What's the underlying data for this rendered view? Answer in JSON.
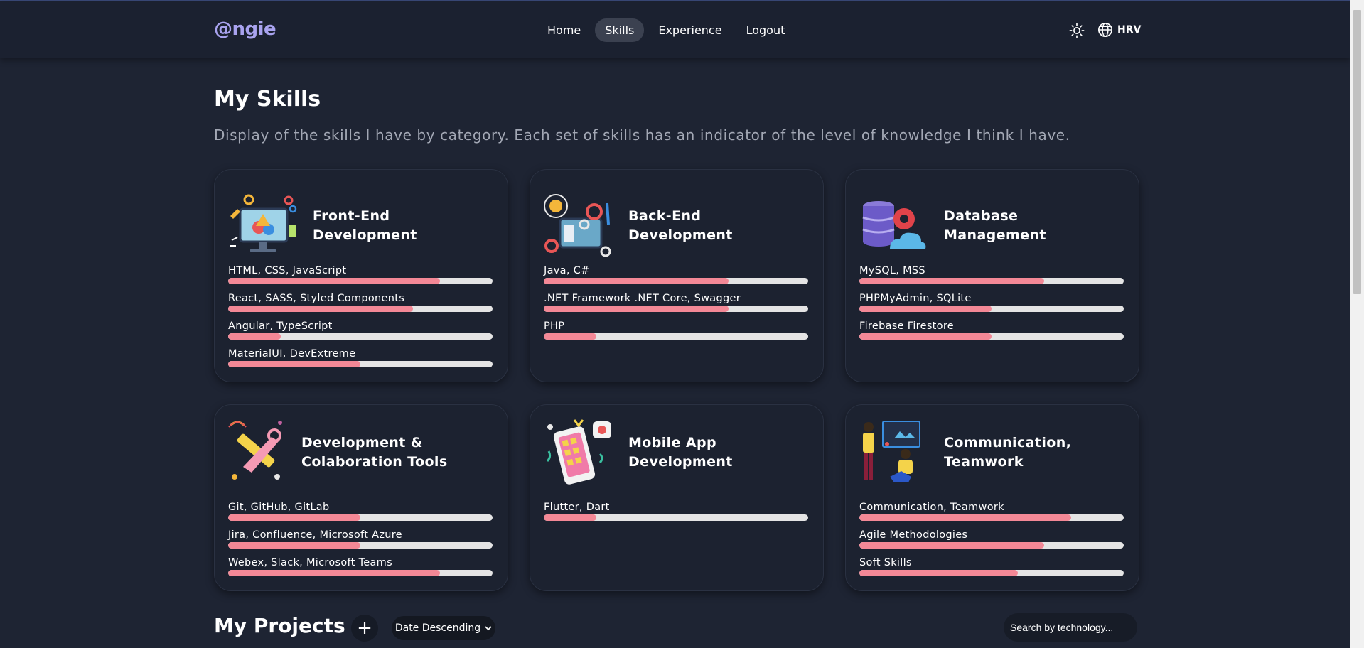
{
  "app": {
    "logo": "@ngie"
  },
  "nav": {
    "items": [
      {
        "label": "Home",
        "active": false
      },
      {
        "label": "Skills",
        "active": true
      },
      {
        "label": "Experience",
        "active": false
      },
      {
        "label": "Logout",
        "active": false
      }
    ],
    "language": "HRV",
    "theme_icon": "sun-icon",
    "language_icon": "globe-icon"
  },
  "page": {
    "title": "My Skills",
    "subtitle": "Display of the skills I have by category. Each set of skills has an indicator of the level of knowledge I think I have."
  },
  "colors": {
    "accent": "#a9a3ef",
    "progress_fill": "#f38896",
    "progress_track": "#e4e4e4",
    "card_bg": "#1c2230",
    "page_bg": "#1e2433"
  },
  "cards": [
    {
      "title": "Front-End Development",
      "icon": "monitor-design-icon",
      "skills": [
        {
          "name": "HTML, CSS, JavaScript",
          "level": 0.8
        },
        {
          "name": "React, SASS, Styled Components",
          "level": 0.7
        },
        {
          "name": "Angular, TypeScript",
          "level": 0.2
        },
        {
          "name": "MaterialUI, DevExtreme",
          "level": 0.5
        }
      ]
    },
    {
      "title": "Back-End Development",
      "icon": "server-gears-icon",
      "skills": [
        {
          "name": "Java, C#",
          "level": 0.7
        },
        {
          "name": ".NET Framework .NET Core, Swagger",
          "level": 0.7
        },
        {
          "name": "PHP",
          "level": 0.2
        }
      ]
    },
    {
      "title": "Database Management",
      "icon": "database-cloud-icon",
      "skills": [
        {
          "name": "MySQL, MSS",
          "level": 0.7
        },
        {
          "name": "PHPMyAdmin, SQLite",
          "level": 0.5
        },
        {
          "name": "Firebase Firestore",
          "level": 0.5
        }
      ]
    },
    {
      "title": "Development & Colaboration Tools",
      "icon": "tools-icon",
      "skills": [
        {
          "name": "Git, GitHub, GitLab",
          "level": 0.5
        },
        {
          "name": "Jira, Confluence, Microsoft Azure",
          "level": 0.5
        },
        {
          "name": "Webex, Slack, Microsoft Teams",
          "level": 0.8
        }
      ]
    },
    {
      "title": "Mobile App Development",
      "icon": "smartphone-icon",
      "skills": [
        {
          "name": "Flutter, Dart",
          "level": 0.2
        }
      ]
    },
    {
      "title": "Communication, Teamwork",
      "icon": "team-presentation-icon",
      "skills": [
        {
          "name": "Communication, Teamwork",
          "level": 0.8
        },
        {
          "name": "Agile Methodologies",
          "level": 0.7
        },
        {
          "name": "Soft Skills",
          "level": 0.6
        }
      ]
    }
  ],
  "projects": {
    "title": "My Projects",
    "add_icon": "plus-icon",
    "sort": {
      "selected": "Date Descending",
      "icon": "chevron-down-icon"
    },
    "search_placeholder": "Search by technology..."
  }
}
